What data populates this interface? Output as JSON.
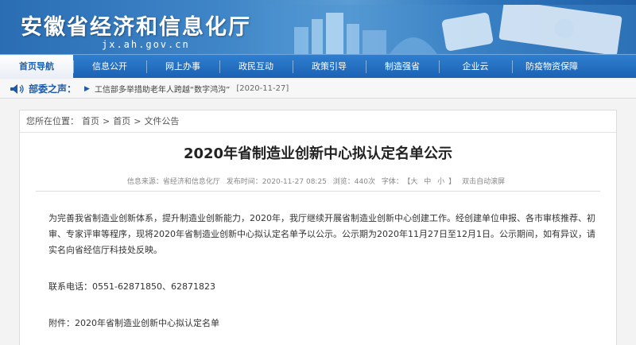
{
  "header": {
    "title": "安徽省经济和信息化厅",
    "url": "jx.ah.gov.cn"
  },
  "nav": {
    "items": [
      {
        "label": "首页导航"
      },
      {
        "label": "信息公开"
      },
      {
        "label": "网上办事"
      },
      {
        "label": "政民互动"
      },
      {
        "label": "政策引导"
      },
      {
        "label": "制造强省"
      },
      {
        "label": "企业云"
      },
      {
        "label": "防疫物资保障"
      }
    ]
  },
  "ticker": {
    "label": "部委之声：",
    "text": "工信部多举措助老年人跨越“数字鸿沟”",
    "date": "[2020-11-27]"
  },
  "breadcrumb": {
    "prefix": "您所在位置：",
    "items": [
      "首页",
      "首页",
      "文件公告"
    ]
  },
  "article": {
    "title": "2020年省制造业创新中心拟认定名单公示",
    "meta": {
      "source": "信息来源：省经济和信息化厅",
      "time": "发布时间：2020-11-27 08:25",
      "views": "浏览：440次",
      "font_label": "字体：",
      "font_big": "大",
      "font_mid": "中",
      "font_small": "小",
      "scroll": "双击自动滚屏"
    },
    "body": "为完善我省制造业创新体系，提升制造业创新能力，2020年，我厅继续开展省制造业创新中心创建工作。经创建单位申报、各市审核推荐、初审、专家评审等程序，现将2020年省制造业创新中心拟认定名单予以公示。公示期为2020年11月27日至12月1日。公示期间，如有异议，请实名向省经信厅科技处反映。",
    "contact": "联系电话：0551-62871850、62871823",
    "attachment_label": "附件：",
    "attachment_name": "2020年省制造业创新中心拟认定名单"
  },
  "colors": {
    "brand_blue": "#1b62b3",
    "nav_blue": "#2f7fd0",
    "ticker_blue": "#1d5aa8"
  }
}
